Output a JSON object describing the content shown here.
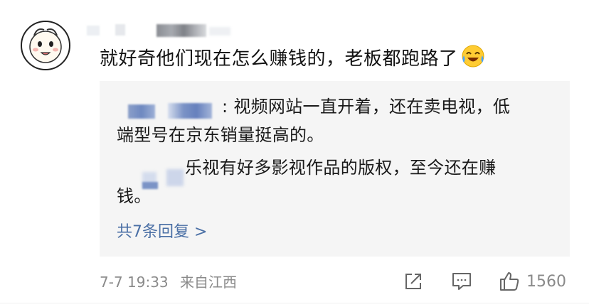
{
  "post": {
    "main_text": "就好奇他们现在怎么赚钱的，老板都跑路了",
    "emoji": "laughing-crying-emoji"
  },
  "replies": [
    {
      "text_line1": ": 视频网站一直开着，还在卖电视，低",
      "text_line2": "端型号在京东销量挺高的。"
    },
    {
      "text_line1": "乐视有好多影视作品的版权，至今还在赚",
      "text_line2": "钱。"
    }
  ],
  "more_replies_label": "共7条回复 >",
  "footer": {
    "date": "7-7 19:33",
    "source": "来自江西",
    "like_count": "1560"
  },
  "colors": {
    "link": "#4a6fa5",
    "meta": "#8a8a8a",
    "reply_bg": "#f5f5f5"
  }
}
